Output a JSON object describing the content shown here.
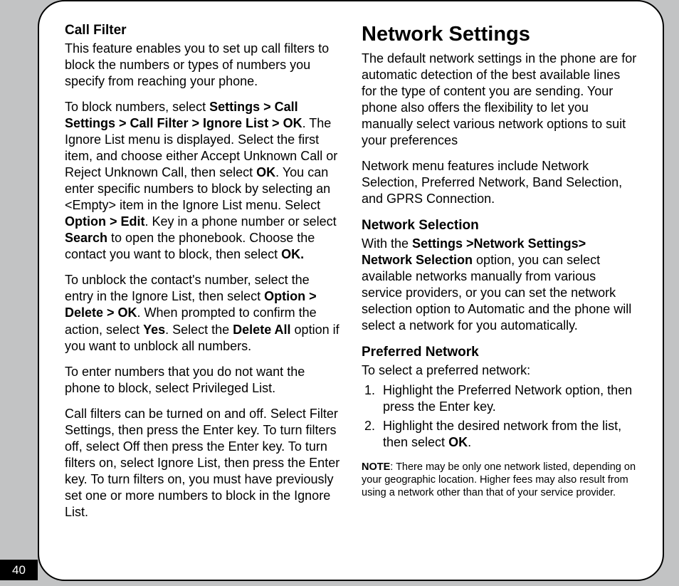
{
  "page_number": "40",
  "left": {
    "heading": "Call Filter",
    "p1": {
      "pre": "This feature enables you to set up call filters to block the numbers or types of numbers you specify from reaching your phone."
    },
    "p2": {
      "a": "To block numbers, select ",
      "b1": "Settings > Call Settings > Call Filter > Ignore List > OK",
      "b": ". The Ignore List menu is displayed. Select the first item, and choose either Accept  Unknown Call or Reject Unknown Call, then select ",
      "b2": "OK",
      "c": ".  You can enter specific numbers to block by selecting an <Empty> item in the Ignore List menu. Select ",
      "b3": "Option > Edit",
      "d": ". Key in a phone number or select ",
      "b4": "Search",
      "e": " to open the phonebook. Choose the contact you want to block, then select ",
      "b5": "OK."
    },
    "p3": {
      "a": "To unblock the contact's number, select the entry in the Ignore List, then select ",
      "b1": "Option > Delete > OK",
      "b": ". When prompted to confirm the action, select ",
      "b2": "Yes",
      "c": ". Select the ",
      "b3": "Delete All",
      "d": " option if you want to unblock all numbers."
    },
    "p4": "To enter numbers that you do not want the phone to block, select Privileged List.",
    "p5": "Call filters can be turned on and off. Select Filter Settings, then press the Enter key. To turn filters off, select Off then press the Enter key. To turn filters on, select Ignore List, then press the Enter key. To turn filters on, you must have previously set one or more numbers to block in the Ignore List."
  },
  "right": {
    "heading": "Network Settings",
    "p1": "The default network settings in the phone are for automatic detection of the best available lines for the type of content you are sending. Your phone also offers the flexibility to let you manually select various network options to suit your preferences",
    "p2": "Network menu features include Network Selection, Preferred Network, Band Selection, and GPRS Connection.",
    "sec1_heading": "Network Selection",
    "sec1_p": {
      "a": "With the ",
      "b1": "Settings >Network Settings> Network Selection",
      "b": " option, you can select available networks manually from various service providers, or you can set the network selection option to Automatic and the phone will select a network for you automatically."
    },
    "sec2_heading": "Preferred Network",
    "sec2_intro": "To select a preferred network:",
    "sec2_items": [
      {
        "num": "1.",
        "text": "Highlight the Preferred Network option, then press the Enter key."
      },
      {
        "num": "2.",
        "a": "Highlight the desired network from the list, then select ",
        "b1": "OK",
        "b": "."
      }
    ],
    "note": {
      "label": "NOTE",
      "text": ": There may be only one network listed, depending on your geographic location. Higher fees may also result from using a network other than that of your service provider."
    }
  }
}
